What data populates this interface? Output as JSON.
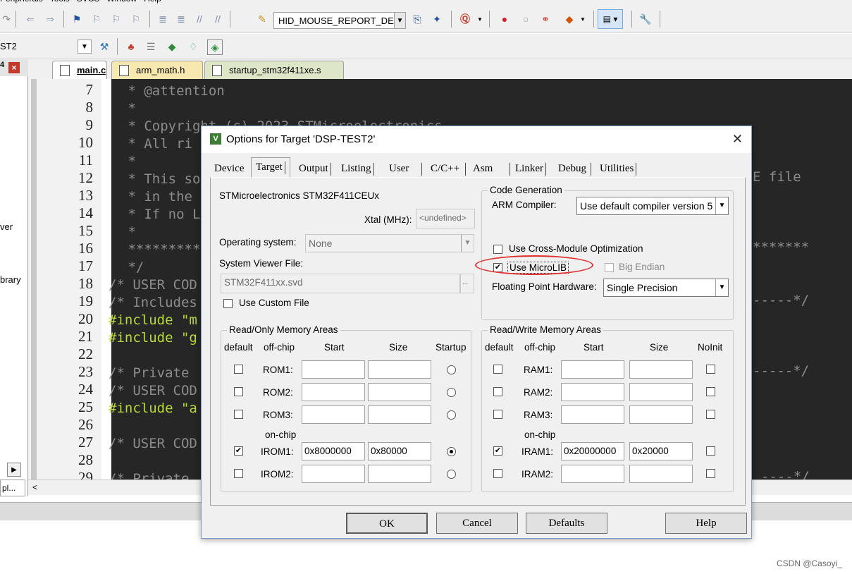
{
  "app": {
    "menu": [
      "Peripherals",
      "Tools",
      "SVCS",
      "Window",
      "Help"
    ],
    "toolbar": {
      "target_dropdown": "HID_MOUSE_REPORT_DESC"
    },
    "project_name": "ST2",
    "left_panel": {
      "tree_fragments": [
        "ver",
        "brary"
      ],
      "bottom_tab": "pl..."
    },
    "editor_tabs": [
      {
        "label": "main.c",
        "active": true
      },
      {
        "label": "arm_math.h",
        "active": false
      },
      {
        "label": "startup_stm32f411xe.s",
        "active": false
      }
    ],
    "line_numbers": [
      "7",
      "8",
      "9",
      "10",
      "11",
      "12",
      "13",
      "14",
      "15",
      "16",
      "17",
      "18",
      "19",
      "20",
      "21",
      "22",
      "23",
      "24",
      "25",
      "26",
      "27",
      "28",
      "29"
    ],
    "code_lines": [
      " * @attention",
      " *",
      " * Copyright (c) 2023 STMicroelectronics",
      " * All ri",
      " *",
      " * This so",
      " * in the",
      " * If no L",
      " *",
      " *********",
      " */",
      "/* USER COD",
      "/* Includes",
      "#include \"m",
      "#include \"g",
      "",
      "/* Private",
      "/* USER COD",
      "#include \"a",
      "",
      "/* USER COD",
      "",
      "/* Private"
    ],
    "code_right": {
      "line12": "E file",
      "line16": "*******",
      "line19": "-----*/",
      "line23": "-----*/",
      "line29": "----*/"
    },
    "watermark": "CSDN @Casoyi_"
  },
  "dialog": {
    "title": "Options for Target 'DSP-TEST2'",
    "tabs": [
      "Device",
      "Target",
      "Output",
      "Listing",
      "User",
      "C/C++",
      "Asm",
      "Linker",
      "Debug",
      "Utilities"
    ],
    "active_tab": "Target",
    "device_name": "STMicroelectronics STM32F411CEUx",
    "xtal_label": "Xtal (MHz):",
    "xtal_value": "<undefined>",
    "os_label": "Operating system:",
    "os_value": "None",
    "svf_label": "System Viewer File:",
    "svf_value": "STM32F411xx.svd",
    "svf_browse": "...",
    "use_custom_file": {
      "label": "Use Custom File",
      "checked": false
    },
    "code_generation": {
      "title": "Code Generation",
      "arm_compiler_label": "ARM Compiler:",
      "arm_compiler_value": "Use default compiler version 5",
      "cross_module": {
        "label": "Use Cross-Module Optimization",
        "checked": false
      },
      "microlib": {
        "label": "Use MicroLIB",
        "checked": true,
        "highlighted": true
      },
      "big_endian": {
        "label": "Big Endian",
        "checked": false,
        "disabled": true
      },
      "fph_label": "Floating Point Hardware:",
      "fph_value": "Single Precision"
    },
    "ro_memory": {
      "title": "Read/Only Memory Areas",
      "headers": [
        "default",
        "off-chip",
        "Start",
        "Size",
        "Startup"
      ],
      "onchip_label": "on-chip",
      "rows": [
        {
          "name": "ROM1:",
          "default": false,
          "start": "",
          "size": "",
          "startup": false
        },
        {
          "name": "ROM2:",
          "default": false,
          "start": "",
          "size": "",
          "startup": false
        },
        {
          "name": "ROM3:",
          "default": false,
          "start": "",
          "size": "",
          "startup": false
        },
        {
          "name": "IROM1:",
          "default": true,
          "start": "0x8000000",
          "size": "0x80000",
          "startup": true
        },
        {
          "name": "IROM2:",
          "default": false,
          "start": "",
          "size": "",
          "startup": false
        }
      ]
    },
    "rw_memory": {
      "title": "Read/Write Memory Areas",
      "headers": [
        "default",
        "off-chip",
        "Start",
        "Size",
        "NoInit"
      ],
      "onchip_label": "on-chip",
      "rows": [
        {
          "name": "RAM1:",
          "default": false,
          "start": "",
          "size": "",
          "noinit": false
        },
        {
          "name": "RAM2:",
          "default": false,
          "start": "",
          "size": "",
          "noinit": false
        },
        {
          "name": "RAM3:",
          "default": false,
          "start": "",
          "size": "",
          "noinit": false
        },
        {
          "name": "IRAM1:",
          "default": true,
          "start": "0x20000000",
          "size": "0x20000",
          "noinit": false
        },
        {
          "name": "IRAM2:",
          "default": false,
          "start": "",
          "size": "",
          "noinit": false
        }
      ]
    },
    "buttons": {
      "ok": "OK",
      "cancel": "Cancel",
      "defaults": "Defaults",
      "help": "Help"
    },
    "highlight_color": "#e03030"
  }
}
